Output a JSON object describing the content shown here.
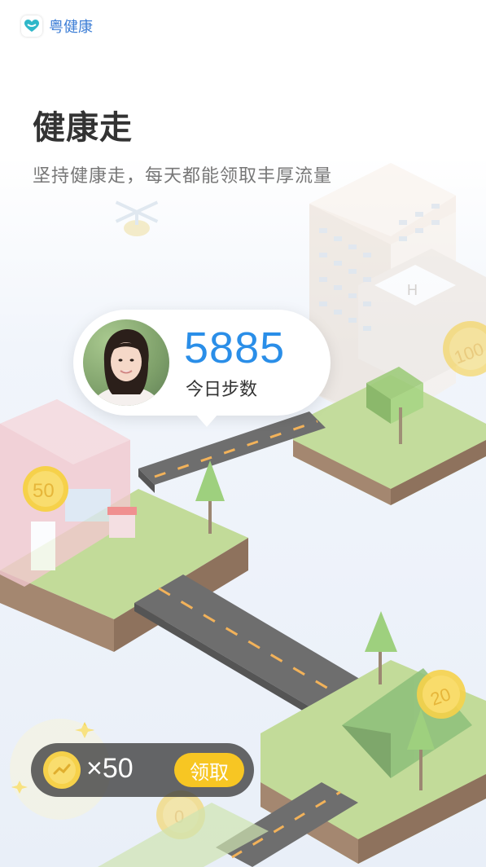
{
  "app": {
    "name": "粤健康",
    "logo_icon": "heart-logo-icon"
  },
  "page": {
    "title": "健康走",
    "subtitle": "坚持健康走，每天都能领取丰厚流量"
  },
  "steps": {
    "value": "5885",
    "label": "今日步数"
  },
  "map_coins": {
    "building": "50",
    "hospital": "100",
    "tent": "20",
    "bottom": "0"
  },
  "reward": {
    "prefix": "×",
    "count": "50",
    "claim_label": "领取"
  },
  "colors": {
    "accent": "#2a8ee8",
    "claim": "#f7c623",
    "coin": "#f6d14a",
    "header": "#3d7ed6"
  }
}
